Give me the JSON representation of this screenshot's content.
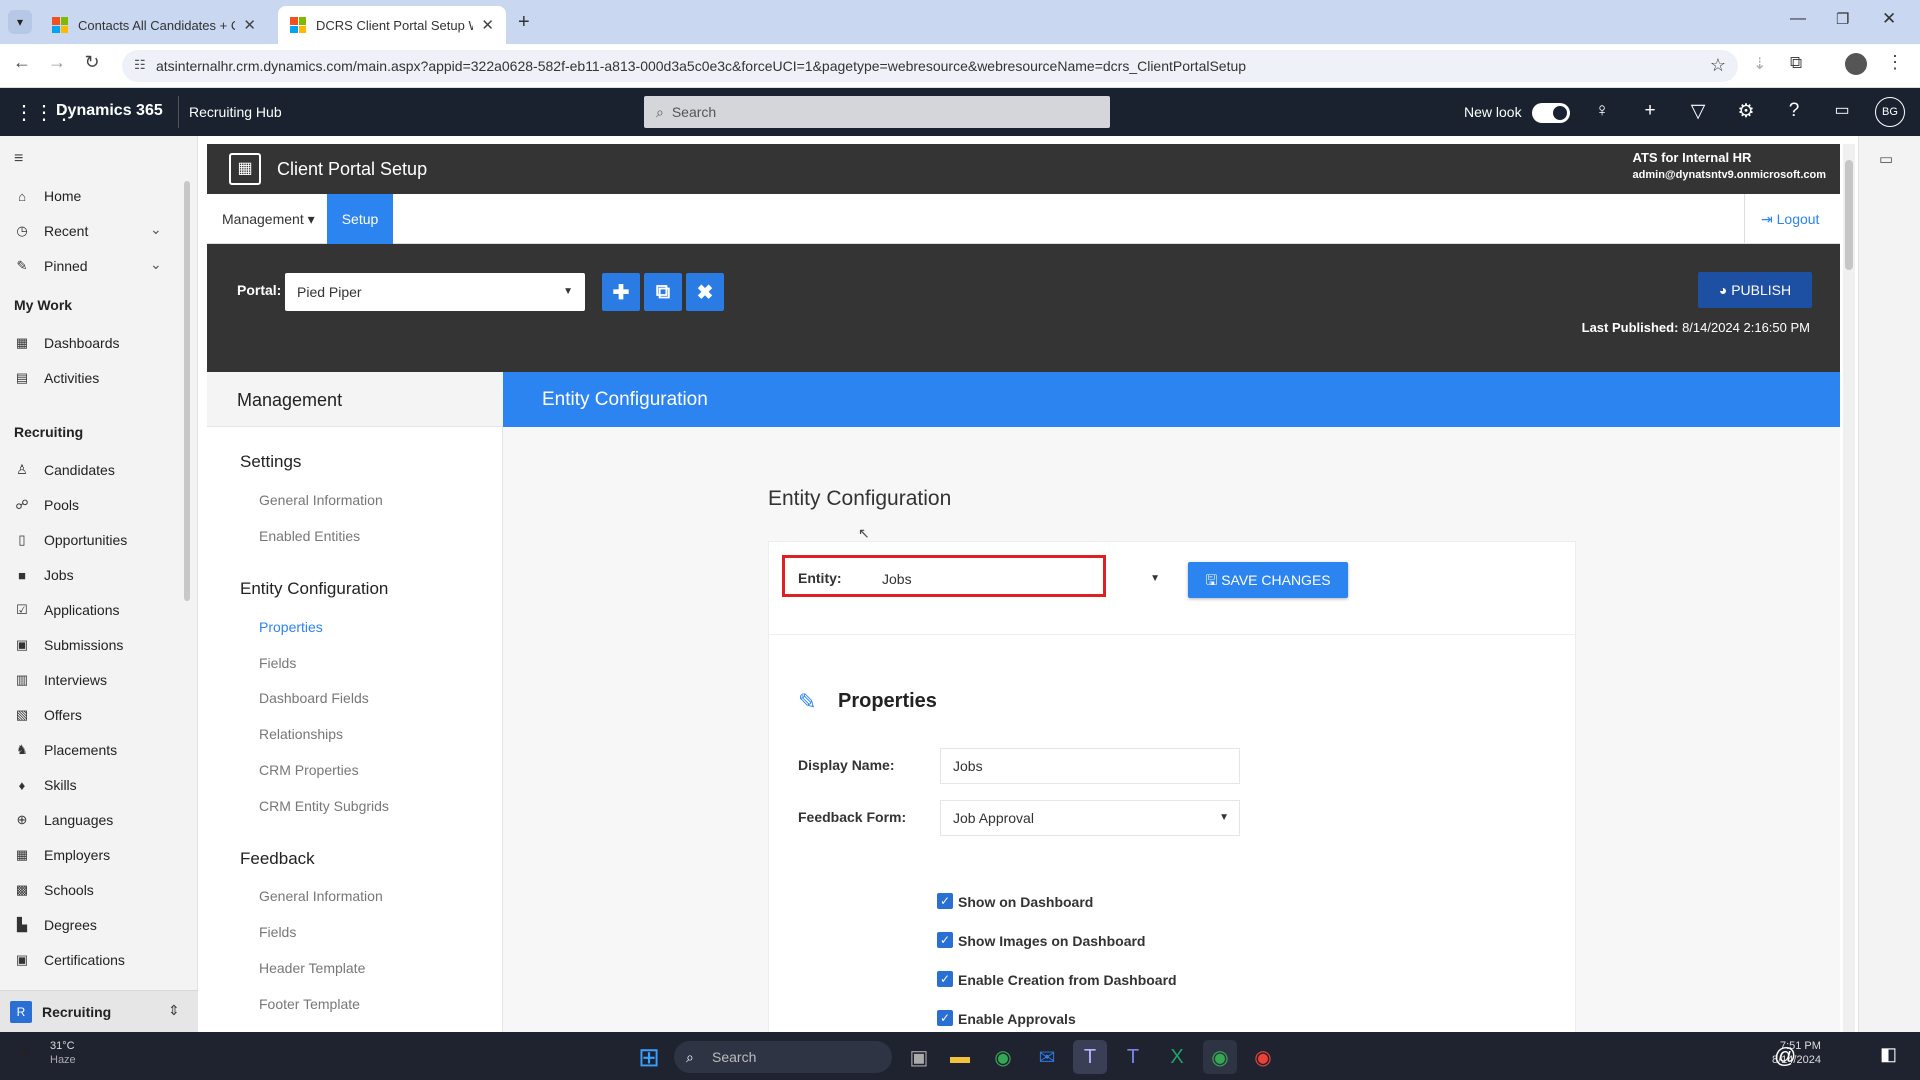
{
  "browser": {
    "tabs": [
      {
        "title": "Contacts All Candidates + Com"
      },
      {
        "title": "DCRS Client Portal Setup Web"
      }
    ],
    "url": "atsinternalhr.crm.dynamics.com/main.aspx?appid=322a0628-582f-eb11-a813-000d3a5c0e3c&forceUCI=1&pagetype=webresource&webresourceName=dcrs_ClientPortalSetup"
  },
  "d365": {
    "app_name": "Dynamics 365",
    "area_name": "Recruiting Hub",
    "search_placeholder": "Search",
    "new_look_label": "New look",
    "new_look_on": true,
    "avatar_initials": "BG"
  },
  "sidebar": {
    "top": [
      {
        "label": "Home",
        "icon": "home-icon"
      },
      {
        "label": "Recent",
        "icon": "clock-icon"
      },
      {
        "label": "Pinned",
        "icon": "pin-icon"
      }
    ],
    "my_work_heading": "My Work",
    "my_work": [
      {
        "label": "Dashboards",
        "icon": "dashboard-icon"
      },
      {
        "label": "Activities",
        "icon": "activities-icon"
      }
    ],
    "recruiting_heading": "Recruiting",
    "recruiting": [
      {
        "label": "Candidates",
        "icon": "person-icon"
      },
      {
        "label": "Pools",
        "icon": "people-icon"
      },
      {
        "label": "Opportunities",
        "icon": "document-icon"
      },
      {
        "label": "Jobs",
        "icon": "briefcase-icon"
      },
      {
        "label": "Applications",
        "icon": "checklist-icon"
      },
      {
        "label": "Submissions",
        "icon": "submit-icon"
      },
      {
        "label": "Interviews",
        "icon": "calendar-icon"
      },
      {
        "label": "Offers",
        "icon": "offer-icon"
      },
      {
        "label": "Placements",
        "icon": "placement-icon"
      },
      {
        "label": "Skills",
        "icon": "skills-icon"
      },
      {
        "label": "Languages",
        "icon": "globe-icon"
      },
      {
        "label": "Employers",
        "icon": "building-icon"
      },
      {
        "label": "Schools",
        "icon": "school-icon"
      },
      {
        "label": "Degrees",
        "icon": "degree-icon"
      },
      {
        "label": "Certifications",
        "icon": "certificate-icon"
      }
    ],
    "area_switcher_letter": "R",
    "area_switcher_label": "Recruiting"
  },
  "portal_app": {
    "title": "Client Portal Setup",
    "org_name": "ATS for Internal HR",
    "user_email": "admin@dynatsntv9.onmicrosoft.com",
    "nav_tabs": [
      {
        "label": "Management ▾",
        "active": false
      },
      {
        "label": "Setup",
        "active": true
      }
    ],
    "logout_label": "Logout",
    "portal_label": "Portal:",
    "portal_value": "Pied Piper",
    "publish_label": "PUBLISH",
    "last_published_label": "Last Published:",
    "last_published_value": "8/14/2024 2:16:50 PM"
  },
  "management": {
    "heading": "Management",
    "sections": [
      {
        "title": "Settings",
        "items": [
          "General Information",
          "Enabled Entities"
        ]
      },
      {
        "title": "Entity Configuration",
        "items": [
          "Properties",
          "Fields",
          "Dashboard Fields",
          "Relationships",
          "CRM Properties",
          "CRM Entity Subgrids"
        ]
      },
      {
        "title": "Feedback",
        "items": [
          "General Information",
          "Fields",
          "Header Template",
          "Footer Template"
        ]
      }
    ],
    "active_item": "Properties"
  },
  "entity_config": {
    "banner_title": "Entity Configuration",
    "page_title": "Entity Configuration",
    "entity_label": "Entity:",
    "entity_value": "Jobs",
    "save_label": "SAVE CHANGES",
    "properties_heading": "Properties",
    "display_name_label": "Display Name:",
    "display_name_value": "Jobs",
    "feedback_form_label": "Feedback Form:",
    "feedback_form_value": "Job Approval",
    "checkboxes": [
      {
        "label": "Show on Dashboard",
        "checked": true
      },
      {
        "label": "Show Images on Dashboard",
        "checked": true
      },
      {
        "label": "Enable Creation from Dashboard",
        "checked": true
      },
      {
        "label": "Enable Approvals",
        "checked": true
      }
    ]
  },
  "taskbar": {
    "weather_temp": "31°C",
    "weather_desc": "Haze",
    "search_placeholder": "Search",
    "time": "7:51 PM",
    "date": "8/14/2024"
  },
  "colors": {
    "accent_blue": "#2c84f0",
    "highlight_red": "#e02020",
    "dark_header": "#1a2230"
  }
}
